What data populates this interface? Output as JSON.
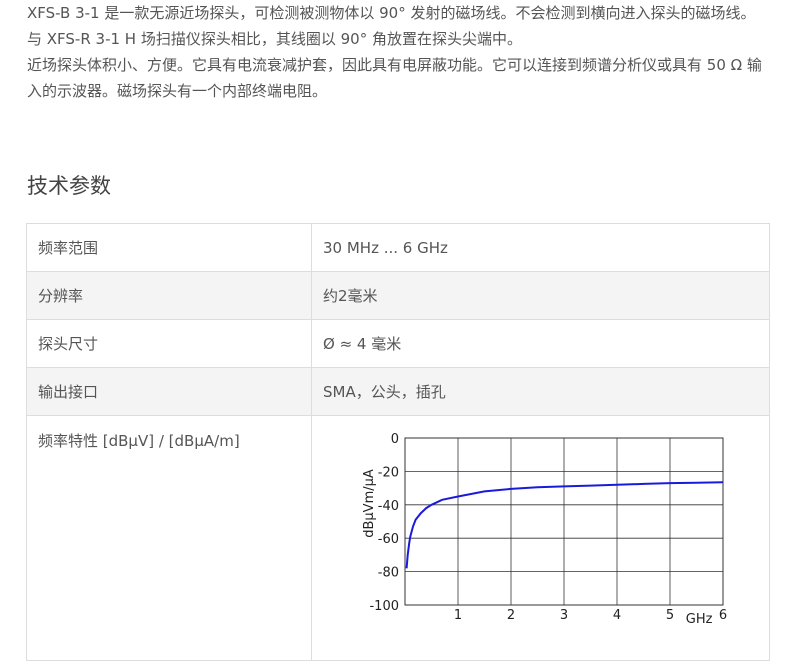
{
  "intro": {
    "paragraphs": [
      "XFS-B 3-1 是一款无源近场探头，可检测被测物体以 90° 发射的磁场线。不会检测到横向进入探头的磁场线。",
      "与 XFS-R 3-1 H 场扫描仪探头相比，其线圈以 90° 角放置在探头尖端中。",
      "近场探头体积小、方便。它具有电流衰减护套，因此具有电屏蔽功能。它可以连接到频谱分析仪或具有 50 Ω 输入的示波器。磁场探头有一个内部终端电阻。"
    ]
  },
  "section_title": "技术参数",
  "specs": {
    "rows": [
      {
        "label": "频率范围",
        "value": "30 MHz ... 6 GHz"
      },
      {
        "label": "分辨率",
        "value": "约2毫米"
      },
      {
        "label": "探头尺寸",
        "value": "Ø ≈ 4 毫米"
      },
      {
        "label": "输出接口",
        "value": "SMA，公头，插孔"
      }
    ],
    "chart_row_label": "频率特性 [dBµV] / [dBµA/m]"
  },
  "chart_data": {
    "type": "line",
    "title": "",
    "xlabel": "GHz",
    "ylabel": "dBµVm/µA",
    "xlim": [
      0,
      6
    ],
    "ylim": [
      -100,
      0
    ],
    "x_ticks": [
      "1",
      "2",
      "3",
      "4",
      "5",
      "6"
    ],
    "y_ticks": [
      "0",
      "-20",
      "-40",
      "-60",
      "-80",
      "-100"
    ],
    "grid": true,
    "line_color": "#1a1adc",
    "series": [
      {
        "x": [
          0.03,
          0.05,
          0.08,
          0.1,
          0.15,
          0.2,
          0.3,
          0.4,
          0.5,
          0.7,
          1.0,
          1.5,
          2.0,
          2.5,
          3.0,
          3.5,
          4.0,
          4.5,
          5.0,
          5.5,
          6.0
        ],
        "values": [
          -78,
          -70,
          -63,
          -59,
          -53,
          -49,
          -45,
          -42,
          -40,
          -37,
          -35,
          -32,
          -30.5,
          -29.5,
          -29,
          -28.5,
          -28,
          -27.5,
          -27,
          -26.8,
          -26.5
        ]
      }
    ]
  }
}
